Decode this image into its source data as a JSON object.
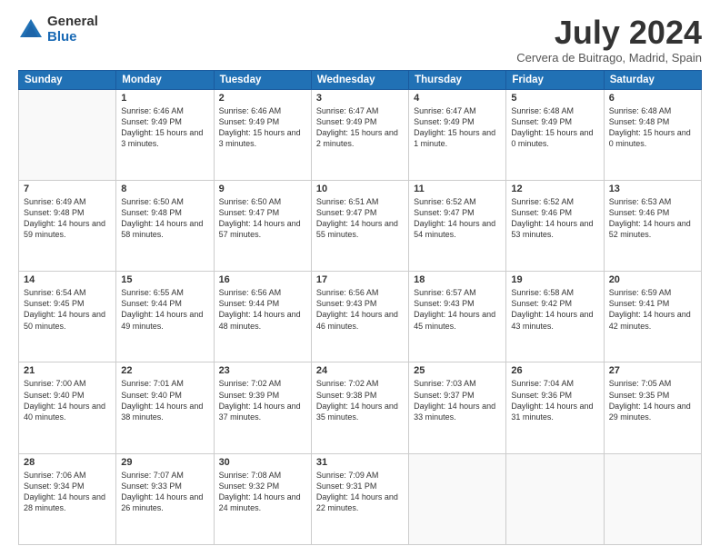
{
  "logo": {
    "general": "General",
    "blue": "Blue"
  },
  "header": {
    "month": "July 2024",
    "location": "Cervera de Buitrago, Madrid, Spain"
  },
  "days_of_week": [
    "Sunday",
    "Monday",
    "Tuesday",
    "Wednesday",
    "Thursday",
    "Friday",
    "Saturday"
  ],
  "weeks": [
    [
      {
        "day": "",
        "info": ""
      },
      {
        "day": "1",
        "info": "Sunrise: 6:46 AM\nSunset: 9:49 PM\nDaylight: 15 hours\nand 3 minutes."
      },
      {
        "day": "2",
        "info": "Sunrise: 6:46 AM\nSunset: 9:49 PM\nDaylight: 15 hours\nand 3 minutes."
      },
      {
        "day": "3",
        "info": "Sunrise: 6:47 AM\nSunset: 9:49 PM\nDaylight: 15 hours\nand 2 minutes."
      },
      {
        "day": "4",
        "info": "Sunrise: 6:47 AM\nSunset: 9:49 PM\nDaylight: 15 hours\nand 1 minute."
      },
      {
        "day": "5",
        "info": "Sunrise: 6:48 AM\nSunset: 9:49 PM\nDaylight: 15 hours\nand 0 minutes."
      },
      {
        "day": "6",
        "info": "Sunrise: 6:48 AM\nSunset: 9:48 PM\nDaylight: 15 hours\nand 0 minutes."
      }
    ],
    [
      {
        "day": "7",
        "info": "Sunrise: 6:49 AM\nSunset: 9:48 PM\nDaylight: 14 hours\nand 59 minutes."
      },
      {
        "day": "8",
        "info": "Sunrise: 6:50 AM\nSunset: 9:48 PM\nDaylight: 14 hours\nand 58 minutes."
      },
      {
        "day": "9",
        "info": "Sunrise: 6:50 AM\nSunset: 9:47 PM\nDaylight: 14 hours\nand 57 minutes."
      },
      {
        "day": "10",
        "info": "Sunrise: 6:51 AM\nSunset: 9:47 PM\nDaylight: 14 hours\nand 55 minutes."
      },
      {
        "day": "11",
        "info": "Sunrise: 6:52 AM\nSunset: 9:47 PM\nDaylight: 14 hours\nand 54 minutes."
      },
      {
        "day": "12",
        "info": "Sunrise: 6:52 AM\nSunset: 9:46 PM\nDaylight: 14 hours\nand 53 minutes."
      },
      {
        "day": "13",
        "info": "Sunrise: 6:53 AM\nSunset: 9:46 PM\nDaylight: 14 hours\nand 52 minutes."
      }
    ],
    [
      {
        "day": "14",
        "info": "Sunrise: 6:54 AM\nSunset: 9:45 PM\nDaylight: 14 hours\nand 50 minutes."
      },
      {
        "day": "15",
        "info": "Sunrise: 6:55 AM\nSunset: 9:44 PM\nDaylight: 14 hours\nand 49 minutes."
      },
      {
        "day": "16",
        "info": "Sunrise: 6:56 AM\nSunset: 9:44 PM\nDaylight: 14 hours\nand 48 minutes."
      },
      {
        "day": "17",
        "info": "Sunrise: 6:56 AM\nSunset: 9:43 PM\nDaylight: 14 hours\nand 46 minutes."
      },
      {
        "day": "18",
        "info": "Sunrise: 6:57 AM\nSunset: 9:43 PM\nDaylight: 14 hours\nand 45 minutes."
      },
      {
        "day": "19",
        "info": "Sunrise: 6:58 AM\nSunset: 9:42 PM\nDaylight: 14 hours\nand 43 minutes."
      },
      {
        "day": "20",
        "info": "Sunrise: 6:59 AM\nSunset: 9:41 PM\nDaylight: 14 hours\nand 42 minutes."
      }
    ],
    [
      {
        "day": "21",
        "info": "Sunrise: 7:00 AM\nSunset: 9:40 PM\nDaylight: 14 hours\nand 40 minutes."
      },
      {
        "day": "22",
        "info": "Sunrise: 7:01 AM\nSunset: 9:40 PM\nDaylight: 14 hours\nand 38 minutes."
      },
      {
        "day": "23",
        "info": "Sunrise: 7:02 AM\nSunset: 9:39 PM\nDaylight: 14 hours\nand 37 minutes."
      },
      {
        "day": "24",
        "info": "Sunrise: 7:02 AM\nSunset: 9:38 PM\nDaylight: 14 hours\nand 35 minutes."
      },
      {
        "day": "25",
        "info": "Sunrise: 7:03 AM\nSunset: 9:37 PM\nDaylight: 14 hours\nand 33 minutes."
      },
      {
        "day": "26",
        "info": "Sunrise: 7:04 AM\nSunset: 9:36 PM\nDaylight: 14 hours\nand 31 minutes."
      },
      {
        "day": "27",
        "info": "Sunrise: 7:05 AM\nSunset: 9:35 PM\nDaylight: 14 hours\nand 29 minutes."
      }
    ],
    [
      {
        "day": "28",
        "info": "Sunrise: 7:06 AM\nSunset: 9:34 PM\nDaylight: 14 hours\nand 28 minutes."
      },
      {
        "day": "29",
        "info": "Sunrise: 7:07 AM\nSunset: 9:33 PM\nDaylight: 14 hours\nand 26 minutes."
      },
      {
        "day": "30",
        "info": "Sunrise: 7:08 AM\nSunset: 9:32 PM\nDaylight: 14 hours\nand 24 minutes."
      },
      {
        "day": "31",
        "info": "Sunrise: 7:09 AM\nSunset: 9:31 PM\nDaylight: 14 hours\nand 22 minutes."
      },
      {
        "day": "",
        "info": ""
      },
      {
        "day": "",
        "info": ""
      },
      {
        "day": "",
        "info": ""
      }
    ]
  ]
}
